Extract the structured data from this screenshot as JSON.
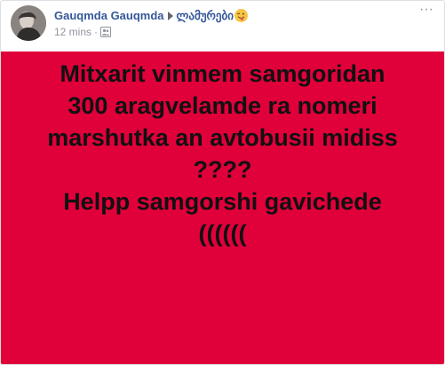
{
  "post": {
    "author": "Gauqmda Gauqmda",
    "group": "ლამურები",
    "timestamp": "12 mins",
    "separator": "·",
    "audience_icon": "group-audience-icon",
    "more_icon": "more-options-icon",
    "more_label": "···",
    "emoji_icon": "winking-tongue-face-emoji",
    "background_color": "#e0003a",
    "text_lines": [
      "Mitxarit vinmem samgoridan",
      "300 aragvelamde ra nomeri",
      "marshutka an avtobusii midiss",
      "????",
      "Helpp samgorshi gavichede",
      "(((((("
    ]
  }
}
